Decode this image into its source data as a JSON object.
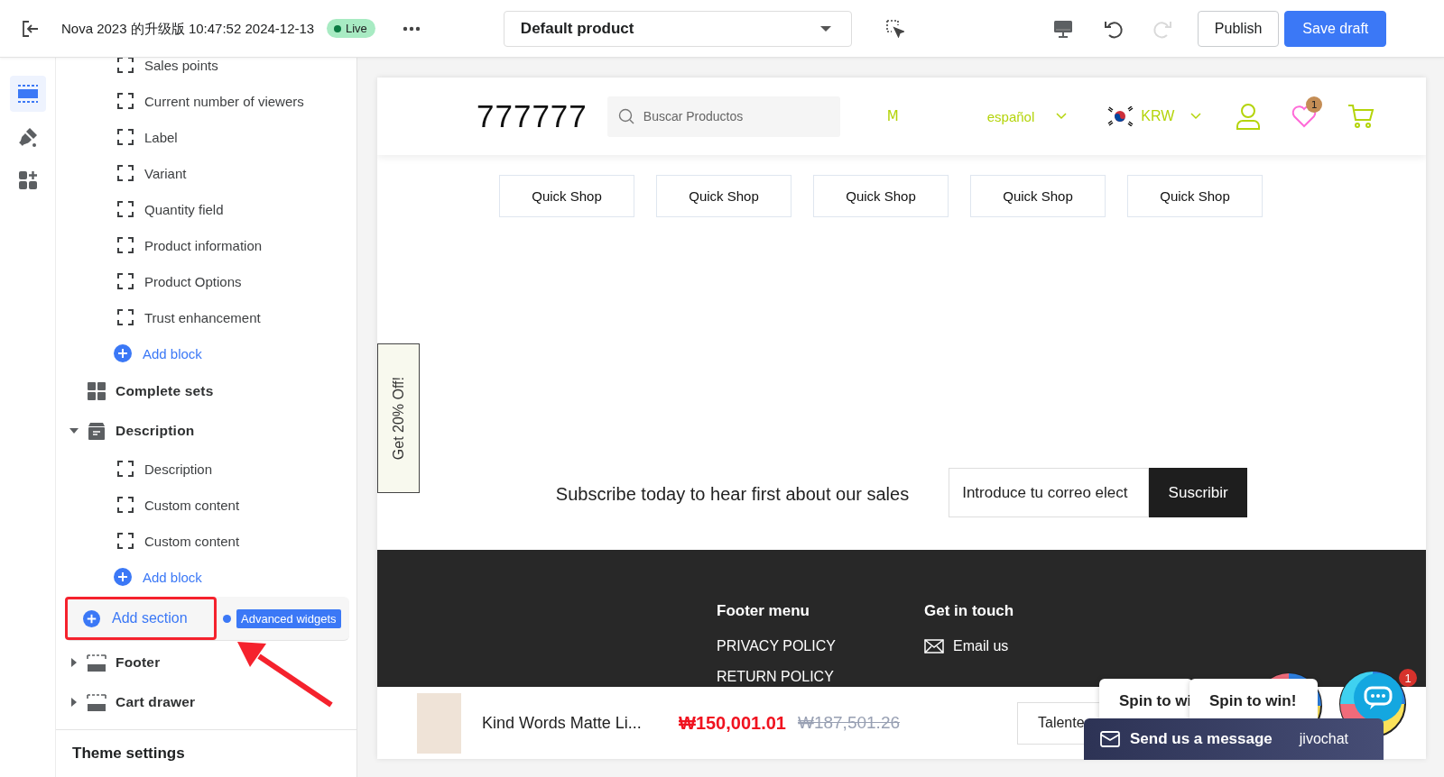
{
  "topbar": {
    "title": "Nova 2023 的升级版 10:47:52 2024-12-13",
    "status": {
      "label": "Live",
      "live": true
    },
    "template": "Default product",
    "redo_disabled": true,
    "buttons": [
      {
        "label": "Publish",
        "kind": "secondary"
      },
      {
        "label": "Save draft",
        "kind": "primary"
      }
    ]
  },
  "rail": [
    {
      "kind": "sections",
      "selected": true
    },
    {
      "kind": "theme",
      "selected": false
    },
    {
      "kind": "apps",
      "selected": false
    }
  ],
  "sidebar": {
    "items": [
      {
        "kind": "block",
        "label": "Sales points"
      },
      {
        "kind": "block",
        "label": "Current number of viewers"
      },
      {
        "kind": "block",
        "label": "Label"
      },
      {
        "kind": "block",
        "label": "Variant"
      },
      {
        "kind": "block",
        "label": "Quantity field"
      },
      {
        "kind": "block",
        "label": "Product information"
      },
      {
        "kind": "block",
        "label": "Product Options"
      },
      {
        "kind": "block",
        "label": "Trust enhancement"
      },
      {
        "kind": "add-block",
        "label": "Add block"
      },
      {
        "kind": "grid-section",
        "label": "Complete sets"
      },
      {
        "kind": "box-section",
        "label": "Description",
        "expanded": true,
        "children": [
          {
            "kind": "block",
            "label": "Description"
          },
          {
            "kind": "block",
            "label": "Custom content"
          },
          {
            "kind": "block",
            "label": "Custom content"
          },
          {
            "kind": "add-block",
            "label": "Add block"
          }
        ]
      },
      {
        "kind": "add-section",
        "label": "Add section",
        "highlighted": true,
        "tooltip": "Advanced widgets"
      },
      {
        "kind": "bar-section",
        "label": "Footer",
        "expanded": false
      },
      {
        "kind": "bar-section",
        "label": "Cart drawer",
        "expanded": false
      }
    ],
    "theme_settings": "Theme settings"
  },
  "preview": {
    "header": {
      "logo": "777777",
      "search_placeholder": "Buscar Productos",
      "menu_item": "M",
      "language": "español",
      "currency": "KRW",
      "wishlist_count": "1"
    },
    "quick_shop": [
      "Quick Shop",
      "Quick Shop",
      "Quick Shop",
      "Quick Shop",
      "Quick Shop"
    ],
    "side_tab": "Get 20% Off!",
    "subscribe": {
      "text": "Subscribe today to hear first about our sales",
      "placeholder": "Introduce tu correo elect",
      "button": "Suscribir"
    },
    "footer": {
      "columns": [
        {
          "title": "Footer menu",
          "links": [
            {
              "label": "PRIVACY POLICY"
            },
            {
              "label": "RETURN POLICY"
            }
          ]
        },
        {
          "title": "Get in touch",
          "links": [
            {
              "kind": "mail",
              "label": "Email us"
            }
          ]
        }
      ]
    },
    "sticky_bar": {
      "product": "Kind Words Matte Li...",
      "price": "₩150,001.01",
      "compare_price": "₩187,501.26",
      "variant": "Talente"
    },
    "widgets": {
      "spin_popups": [
        "Spin to wi",
        "Spin to win!"
      ],
      "chat_badge": "1",
      "chat_bar": "Send us a message",
      "chat_brand": "jivochat"
    }
  }
}
